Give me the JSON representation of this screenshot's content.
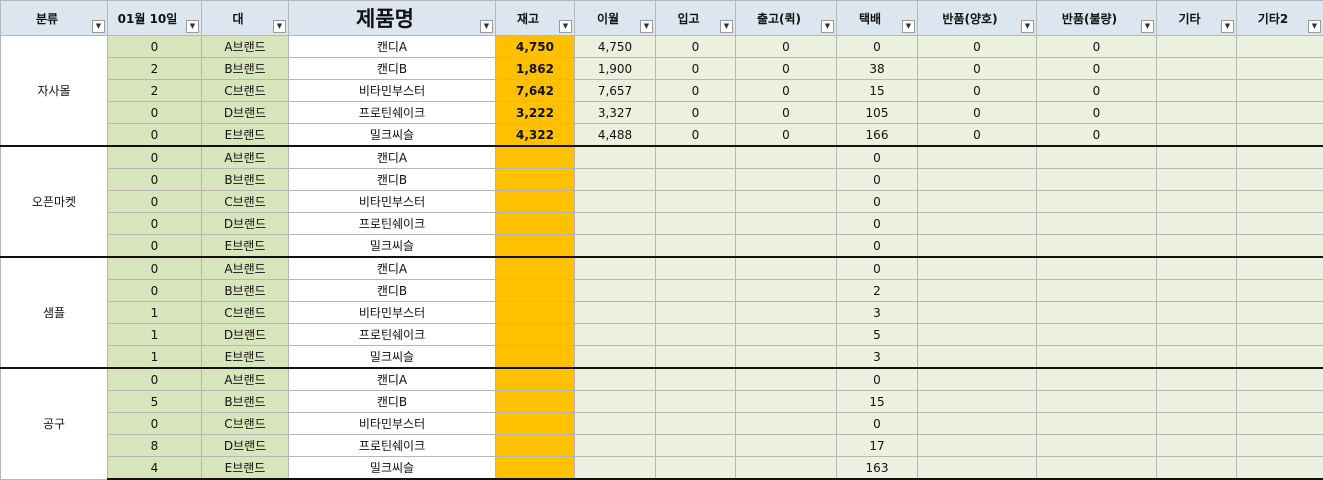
{
  "headers": [
    {
      "key": "category",
      "label": "분류"
    },
    {
      "key": "date",
      "label": "01월 10일"
    },
    {
      "key": "brand",
      "label": "대"
    },
    {
      "key": "product",
      "label": "제품명"
    },
    {
      "key": "stock",
      "label": "재고"
    },
    {
      "key": "prev",
      "label": "이월"
    },
    {
      "key": "in",
      "label": "입고"
    },
    {
      "key": "out",
      "label": "출고(퀵)"
    },
    {
      "key": "ship",
      "label": "택배"
    },
    {
      "key": "ret_good",
      "label": "반품(양호)"
    },
    {
      "key": "ret_bad",
      "label": "반품(불량)"
    },
    {
      "key": "etc",
      "label": "기타"
    },
    {
      "key": "etc2",
      "label": "기타2"
    }
  ],
  "filter_glyph": "▼",
  "groups": [
    {
      "category": "자사몰",
      "rows": [
        {
          "date": "0",
          "brand": "A브랜드",
          "product": "캔디A",
          "stock": "4,750",
          "prev": "4,750",
          "in": "0",
          "out": "0",
          "ship": "0",
          "ret_good": "0",
          "ret_bad": "0",
          "etc": "",
          "etc2": ""
        },
        {
          "date": "2",
          "brand": "B브랜드",
          "product": "캔디B",
          "stock": "1,862",
          "prev": "1,900",
          "in": "0",
          "out": "0",
          "ship": "38",
          "ret_good": "0",
          "ret_bad": "0",
          "etc": "",
          "etc2": ""
        },
        {
          "date": "2",
          "brand": "C브랜드",
          "product": "비타민부스터",
          "stock": "7,642",
          "prev": "7,657",
          "in": "0",
          "out": "0",
          "ship": "15",
          "ret_good": "0",
          "ret_bad": "0",
          "etc": "",
          "etc2": ""
        },
        {
          "date": "0",
          "brand": "D브랜드",
          "product": "프로틴쉐이크",
          "stock": "3,222",
          "prev": "3,327",
          "in": "0",
          "out": "0",
          "ship": "105",
          "ret_good": "0",
          "ret_bad": "0",
          "etc": "",
          "etc2": ""
        },
        {
          "date": "0",
          "brand": "E브랜드",
          "product": "밀크씨슬",
          "stock": "4,322",
          "prev": "4,488",
          "in": "0",
          "out": "0",
          "ship": "166",
          "ret_good": "0",
          "ret_bad": "0",
          "etc": "",
          "etc2": ""
        }
      ]
    },
    {
      "category": "오픈마켓",
      "rows": [
        {
          "date": "0",
          "brand": "A브랜드",
          "product": "캔디A",
          "stock": "",
          "prev": "",
          "in": "",
          "out": "",
          "ship": "0",
          "ret_good": "",
          "ret_bad": "",
          "etc": "",
          "etc2": ""
        },
        {
          "date": "0",
          "brand": "B브랜드",
          "product": "캔디B",
          "stock": "",
          "prev": "",
          "in": "",
          "out": "",
          "ship": "0",
          "ret_good": "",
          "ret_bad": "",
          "etc": "",
          "etc2": ""
        },
        {
          "date": "0",
          "brand": "C브랜드",
          "product": "비타민부스터",
          "stock": "",
          "prev": "",
          "in": "",
          "out": "",
          "ship": "0",
          "ret_good": "",
          "ret_bad": "",
          "etc": "",
          "etc2": ""
        },
        {
          "date": "0",
          "brand": "D브랜드",
          "product": "프로틴쉐이크",
          "stock": "",
          "prev": "",
          "in": "",
          "out": "",
          "ship": "0",
          "ret_good": "",
          "ret_bad": "",
          "etc": "",
          "etc2": ""
        },
        {
          "date": "0",
          "brand": "E브랜드",
          "product": "밀크씨슬",
          "stock": "",
          "prev": "",
          "in": "",
          "out": "",
          "ship": "0",
          "ret_good": "",
          "ret_bad": "",
          "etc": "",
          "etc2": ""
        }
      ]
    },
    {
      "category": "샘플",
      "rows": [
        {
          "date": "0",
          "brand": "A브랜드",
          "product": "캔디A",
          "stock": "",
          "prev": "",
          "in": "",
          "out": "",
          "ship": "0",
          "ret_good": "",
          "ret_bad": "",
          "etc": "",
          "etc2": ""
        },
        {
          "date": "0",
          "brand": "B브랜드",
          "product": "캔디B",
          "stock": "",
          "prev": "",
          "in": "",
          "out": "",
          "ship": "2",
          "ret_good": "",
          "ret_bad": "",
          "etc": "",
          "etc2": ""
        },
        {
          "date": "1",
          "brand": "C브랜드",
          "product": "비타민부스터",
          "stock": "",
          "prev": "",
          "in": "",
          "out": "",
          "ship": "3",
          "ret_good": "",
          "ret_bad": "",
          "etc": "",
          "etc2": ""
        },
        {
          "date": "1",
          "brand": "D브랜드",
          "product": "프로틴쉐이크",
          "stock": "",
          "prev": "",
          "in": "",
          "out": "",
          "ship": "5",
          "ret_good": "",
          "ret_bad": "",
          "etc": "",
          "etc2": ""
        },
        {
          "date": "1",
          "brand": "E브랜드",
          "product": "밀크씨슬",
          "stock": "",
          "prev": "",
          "in": "",
          "out": "",
          "ship": "3",
          "ret_good": "",
          "ret_bad": "",
          "etc": "",
          "etc2": ""
        }
      ]
    },
    {
      "category": "공구",
      "rows": [
        {
          "date": "0",
          "brand": "A브랜드",
          "product": "캔디A",
          "stock": "",
          "prev": "",
          "in": "",
          "out": "",
          "ship": "0",
          "ret_good": "",
          "ret_bad": "",
          "etc": "",
          "etc2": ""
        },
        {
          "date": "5",
          "brand": "B브랜드",
          "product": "캔디B",
          "stock": "",
          "prev": "",
          "in": "",
          "out": "",
          "ship": "15",
          "ret_good": "",
          "ret_bad": "",
          "etc": "",
          "etc2": ""
        },
        {
          "date": "0",
          "brand": "C브랜드",
          "product": "비타민부스터",
          "stock": "",
          "prev": "",
          "in": "",
          "out": "",
          "ship": "0",
          "ret_good": "",
          "ret_bad": "",
          "etc": "",
          "etc2": ""
        },
        {
          "date": "8",
          "brand": "D브랜드",
          "product": "프로틴쉐이크",
          "stock": "",
          "prev": "",
          "in": "",
          "out": "",
          "ship": "17",
          "ret_good": "",
          "ret_bad": "",
          "etc": "",
          "etc2": ""
        },
        {
          "date": "4",
          "brand": "E브랜드",
          "product": "밀크씨슬",
          "stock": "",
          "prev": "",
          "in": "",
          "out": "",
          "ship": "163",
          "ret_good": "",
          "ret_bad": "",
          "etc": "",
          "etc2": ""
        }
      ]
    }
  ]
}
